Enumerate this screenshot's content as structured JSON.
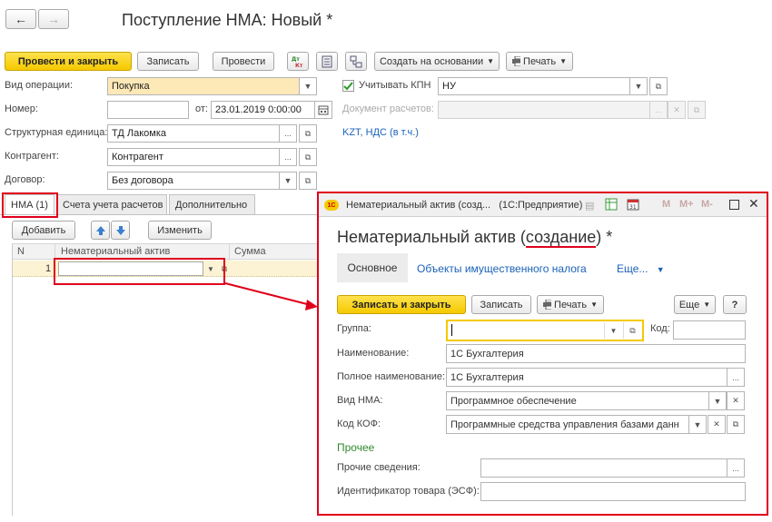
{
  "window": {
    "title": "Поступление НМА: Новый *"
  },
  "nav": {
    "back": "←",
    "forward": "→"
  },
  "toolbar": {
    "post_close": "Провести и закрыть",
    "save": "Записать",
    "post": "Провести",
    "create_based": "Создать на основании",
    "print": "Печать"
  },
  "form": {
    "operation_label": "Вид операции:",
    "operation_value": "Покупка",
    "kpn_label": "Учитывать КПН",
    "kpn_value": "НУ",
    "number_label": "Номер:",
    "number_value": "",
    "from_label": "от:",
    "date_value": "23.01.2019 0:00:00",
    "payment_doc_label": "Документ расчетов:",
    "struct_unit_label": "Структурная единица:",
    "struct_unit_value": "ТД Лакомка",
    "currency_link": "KZT, НДС (в т.ч.)",
    "counterparty_label": "Контрагент:",
    "counterparty_value": "Контрагент",
    "contract_label": "Договор:",
    "contract_value": "Без договора"
  },
  "tabs": [
    "НМА (1)",
    "Счета учета расчетов",
    "Дополнительно"
  ],
  "table": {
    "add": "Добавить",
    "edit": "Изменить",
    "columns": [
      "N",
      "Нематериальный актив",
      "Сумма"
    ],
    "rows": [
      {
        "n": "1",
        "asset": "",
        "sum": ""
      }
    ]
  },
  "dialog": {
    "window_title": "Нематериальный актив (созд...   (1С:Предприятие)",
    "logo": "1С",
    "title_main": "Нематериальный актив (",
    "title_highlight": "создание",
    "title_end": ") *",
    "tabs": [
      "Основное",
      "Объекты имущественного налога",
      "Еще..."
    ],
    "save_close": "Записать и закрыть",
    "save": "Записать",
    "print": "Печать",
    "more": "Еще",
    "help": "?",
    "group_label": "Группа:",
    "group_value": "",
    "code_label": "Код:",
    "code_value": "",
    "name_label": "Наименование:",
    "name_value": "1С Бухгалтерия",
    "fullname_label": "Полное наименование:",
    "fullname_value": "1С Бухгалтерия",
    "kind_label": "Вид НМА:",
    "kind_value": "Программное обеспечение",
    "kof_label": "Код КОФ:",
    "kof_value": "Программные средства управления базами данн",
    "other_section": "Прочее",
    "other_info_label": "Прочие сведения:",
    "other_info_value": "",
    "esf_label": "Идентификатор товара (ЭСФ):",
    "esf_value": "",
    "titlebar_buttons": [
      "M",
      "M+",
      "M-"
    ]
  },
  "colors": {
    "accent_yellow": "#f5c900",
    "red_annotation": "#e0001b",
    "link": "#1a62b8",
    "section_green": "#2e8b2e"
  }
}
